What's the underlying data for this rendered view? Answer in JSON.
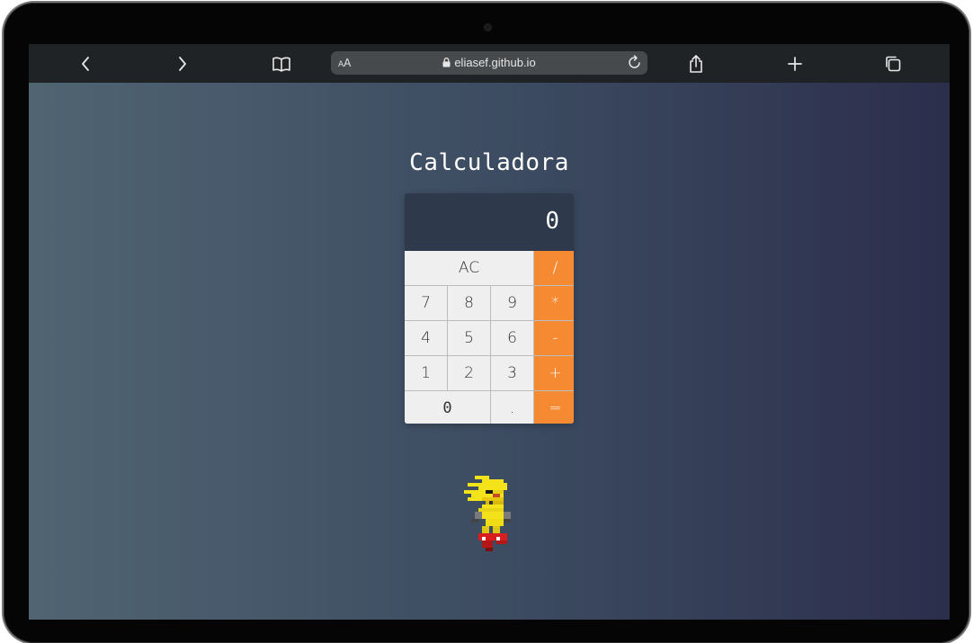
{
  "browser": {
    "text_size_label_small": "A",
    "text_size_label_large": "A",
    "url": "eliasef.github.io",
    "icons": [
      "back-icon",
      "forward-icon",
      "bookmarks-icon",
      "lock-icon",
      "reload-icon",
      "share-icon",
      "new-tab-icon",
      "tabs-icon"
    ]
  },
  "page": {
    "title": "Calculadora"
  },
  "calculator": {
    "display": "0",
    "keys": {
      "ac": "AC",
      "divide": "/",
      "multiply": "*",
      "minus": "-",
      "plus": "+",
      "equals": "=",
      "dot": ".",
      "k0": "0",
      "k1": "1",
      "k2": "2",
      "k3": "3",
      "k4": "4",
      "k5": "5",
      "k6": "6",
      "k7": "7",
      "k8": "8",
      "k9": "9"
    },
    "colors": {
      "operator": "#f58a32",
      "display_bg": "#2e3a4b",
      "key_bg": "#efefef"
    }
  }
}
